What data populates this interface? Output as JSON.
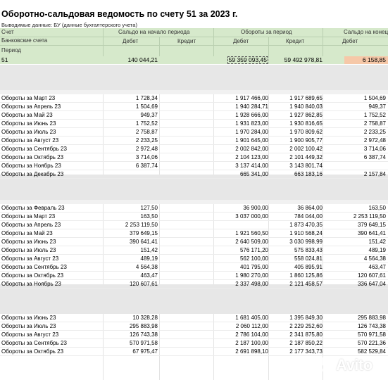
{
  "title": "Оборотно-сальдовая ведомость по счету 51 за 2023 г.",
  "subtitle": "Выводимые данные: БУ (данные бухгалтерского учета)",
  "header": {
    "schet": "Счет",
    "bank": "Банковские счета",
    "period": "Период",
    "saldo_start": "Сальдо на начало периода",
    "turnover": "Обороты за период",
    "saldo_end": "Сальдо на конец",
    "debit": "Дебет",
    "credit": "Кредит"
  },
  "account_row": {
    "account": "51",
    "saldo_debit": "140 044,21",
    "turn_debit": "59 359 093,45",
    "turn_credit": "59 492 978,81",
    "end_debit": "6 158,85"
  },
  "block1": [
    {
      "label": "Обороты за Март 23",
      "c1": "1 728,34",
      "c2": "",
      "c3": "1 917 466,00",
      "c4": "1 917 689,65",
      "c5": "1 504,69"
    },
    {
      "label": "Обороты за Апрель 23",
      "c1": "1 504,69",
      "c2": "",
      "c3": "1 940 284,71",
      "c4": "1 940 840,03",
      "c5": "949,37"
    },
    {
      "label": "Обороты за Май 23",
      "c1": "949,37",
      "c2": "",
      "c3": "1 928 666,00",
      "c4": "1 927 862,85",
      "c5": "1 752,52"
    },
    {
      "label": "Обороты за Июнь 23",
      "c1": "1 752,52",
      "c2": "",
      "c3": "1 931 823,00",
      "c4": "1 930 816,65",
      "c5": "2 758,87"
    },
    {
      "label": "Обороты за Июль 23",
      "c1": "2 758,87",
      "c2": "",
      "c3": "1 970 284,00",
      "c4": "1 970 809,62",
      "c5": "2 233,25"
    },
    {
      "label": "Обороты за Август 23",
      "c1": "2 233,25",
      "c2": "",
      "c3": "1 901 645,00",
      "c4": "1 900 905,77",
      "c5": "2 972,48"
    },
    {
      "label": "Обороты за Сентябрь 23",
      "c1": "2 972,48",
      "c2": "",
      "c3": "2 002 842,00",
      "c4": "2 002 100,42",
      "c5": "3 714,06"
    },
    {
      "label": "Обороты за Октябрь 23",
      "c1": "3 714,06",
      "c2": "",
      "c3": "2 104 123,00",
      "c4": "2 101 449,32",
      "c5": "6 387,74"
    },
    {
      "label": "Обороты за Ноябрь 23",
      "c1": "6 387,74",
      "c2": "",
      "c3": "3 137 414,00",
      "c4": "3 143 801,74",
      "c5": ""
    },
    {
      "label": "Обороты за Декабрь 23",
      "c1": "",
      "c2": "",
      "c3": "665 341,00",
      "c4": "663 183,16",
      "c5": "2 157,84"
    }
  ],
  "block2": [
    {
      "label": "Обороты за Февраль 23",
      "c1": "127,50",
      "c2": "",
      "c3": "36 900,00",
      "c4": "36 864,00",
      "c5": "163,50"
    },
    {
      "label": "Обороты за Март 23",
      "c1": "163,50",
      "c2": "",
      "c3": "3 037 000,00",
      "c4": "784 044,00",
      "c5": "2 253 119,50"
    },
    {
      "label": "Обороты за Апрель 23",
      "c1": "2 253 119,50",
      "c2": "",
      "c3": "",
      "c4": "1 873 470,35",
      "c5": "379 649,15"
    },
    {
      "label": "Обороты за Май 23",
      "c1": "379 649,15",
      "c2": "",
      "c3": "1 921 560,50",
      "c4": "1 910 568,24",
      "c5": "390 641,41"
    },
    {
      "label": "Обороты за Июнь 23",
      "c1": "390 641,41",
      "c2": "",
      "c3": "2 640 509,00",
      "c4": "3 030 998,99",
      "c5": "151,42"
    },
    {
      "label": "Обороты за Июль 23",
      "c1": "151,42",
      "c2": "",
      "c3": "576 171,20",
      "c4": "575 833,43",
      "c5": "489,19"
    },
    {
      "label": "Обороты за Август 23",
      "c1": "489,19",
      "c2": "",
      "c3": "562 100,00",
      "c4": "558 024,81",
      "c5": "4 564,38"
    },
    {
      "label": "Обороты за Сентябрь 23",
      "c1": "4 564,38",
      "c2": "",
      "c3": "401 795,00",
      "c4": "405 895,91",
      "c5": "463,47"
    },
    {
      "label": "Обороты за Октябрь 23",
      "c1": "463,47",
      "c2": "",
      "c3": "1 980 270,00",
      "c4": "1 860 125,86",
      "c5": "120 607,61"
    },
    {
      "label": "Обороты за Ноябрь 23",
      "c1": "120 607,61",
      "c2": "",
      "c3": "2 337 498,00",
      "c4": "2 121 458,57",
      "c5": "336 647,04"
    }
  ],
  "block3": [
    {
      "label": "Обороты за Июнь 23",
      "c1": "10 328,28",
      "c2": "",
      "c3": "1 681 405,00",
      "c4": "1 395 849,30",
      "c5": "295 883,98"
    },
    {
      "label": "Обороты за Июль 23",
      "c1": "295 883,98",
      "c2": "",
      "c3": "2 060 112,00",
      "c4": "2 229 252,60",
      "c5": "126 743,38"
    },
    {
      "label": "Обороты за Август 23",
      "c1": "126 743,38",
      "c2": "",
      "c3": "2 786 104,00",
      "c4": "2 341 875,80",
      "c5": "570 971,58"
    },
    {
      "label": "Обороты за Сентябрь 23",
      "c1": "570 971,58",
      "c2": "",
      "c3": "2 187 100,00",
      "c4": "2 187 850,22",
      "c5": "570 221,36"
    },
    {
      "label": "Обороты за Октябрь 23",
      "c1": "67 975,47",
      "c2": "",
      "c3": "2 691 898,10",
      "c4": "2 177 343,73",
      "c5": "582 529,84"
    }
  ],
  "watermark": "Avito"
}
